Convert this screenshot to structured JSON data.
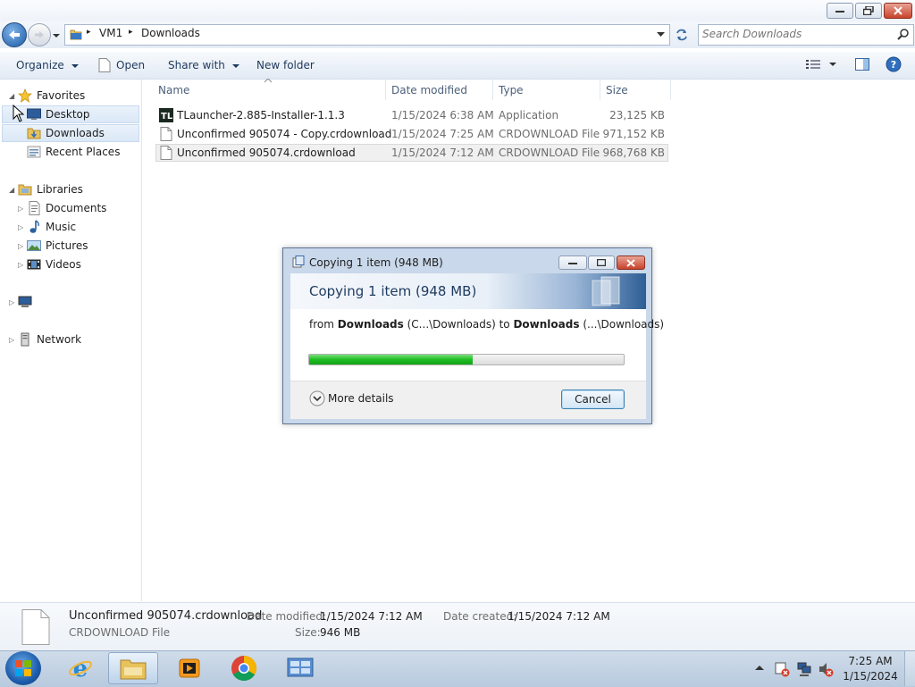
{
  "nav": {
    "breadcrumb": [
      "VM1",
      "Downloads"
    ],
    "search_placeholder": "Search Downloads"
  },
  "toolbar": {
    "organize": "Organize",
    "open": "Open",
    "share_with": "Share with",
    "new_folder": "New folder"
  },
  "sidebar": {
    "favorites": "Favorites",
    "favorites_items": [
      "Desktop",
      "Downloads",
      "Recent Places"
    ],
    "libraries": "Libraries",
    "libraries_items": [
      "Documents",
      "Music",
      "Pictures",
      "Videos"
    ],
    "network": "Network"
  },
  "columns": [
    "Name",
    "Date modified",
    "Type",
    "Size"
  ],
  "files": [
    {
      "name": "TLauncher-2.885-Installer-1.1.3",
      "date": "1/15/2024 6:38 AM",
      "type": "Application",
      "size": "23,125 KB",
      "icon": "tlauncher-icon"
    },
    {
      "name": "Unconfirmed 905074 - Copy.crdownload",
      "date": "1/15/2024 7:25 AM",
      "type": "CRDOWNLOAD File",
      "size": "971,152 KB",
      "icon": "file-icon"
    },
    {
      "name": "Unconfirmed 905074.crdownload",
      "date": "1/15/2024 7:12 AM",
      "type": "CRDOWNLOAD File",
      "size": "968,768 KB",
      "icon": "file-icon"
    }
  ],
  "details": {
    "filename": "Unconfirmed 905074.crdownload",
    "filetype": "CRDOWNLOAD File",
    "date_modified_label": "Date modified:",
    "date_modified": "1/15/2024 7:12 AM",
    "date_created_label": "Date created:",
    "date_created": "1/15/2024 7:12 AM",
    "size_label": "Size:",
    "size": "946 MB"
  },
  "dialog": {
    "title": "Copying 1 item (948 MB)",
    "heading": "Copying 1 item (948 MB)",
    "from_word": "from",
    "src_name": "Downloads",
    "src_path": "(C...\\Downloads)",
    "to_word": "to",
    "dst_name": "Downloads",
    "dst_path": "(...\\Downloads)",
    "progress": 0.52,
    "more_details": "More details",
    "cancel": "Cancel"
  },
  "taskbar": {
    "apps": [
      "internet-explorer-icon",
      "file-explorer-icon",
      "media-player-icon",
      "chrome-icon",
      "control-panel-icon"
    ],
    "clock_time": "7:25 AM",
    "clock_date": "1/15/2024"
  },
  "colors": {
    "progress_green": "#1fbd23",
    "selection_blue": "#dbe8f6",
    "link_blue": "#1e395b"
  }
}
